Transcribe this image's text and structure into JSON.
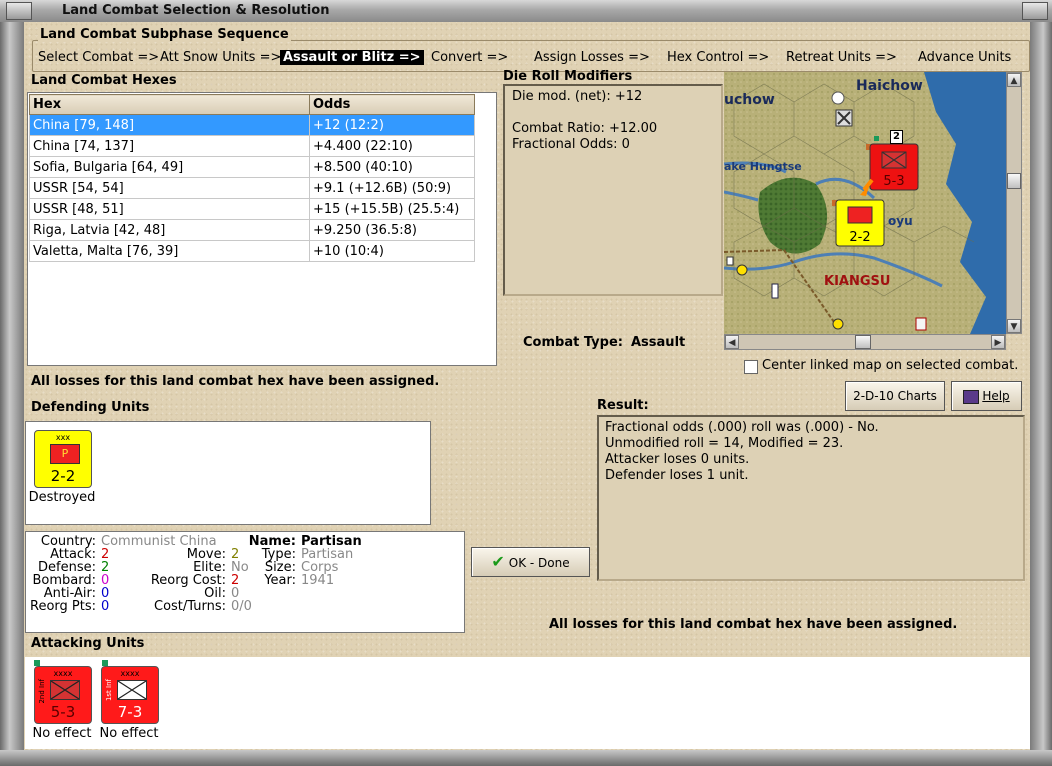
{
  "window": {
    "title": "Land Combat Selection & Resolution"
  },
  "subphase": {
    "title": "Land Combat Subphase Sequence",
    "phases": [
      "Select Combat =>",
      "Att Snow Units =>",
      "Assault or Blitz =>",
      "Convert =>",
      "Assign Losses =>",
      "Hex Control =>",
      "Retreat Units =>",
      "Advance Units"
    ],
    "current_index": 2
  },
  "hexes": {
    "title": "Land Combat Hexes",
    "columns": [
      "Hex",
      "Odds"
    ],
    "rows": [
      [
        "China [79, 148]",
        "+12 (12:2)"
      ],
      [
        "China [74, 137]",
        "+4.400 (22:10)"
      ],
      [
        "Sofia, Bulgaria [64, 49]",
        "+8.500 (40:10)"
      ],
      [
        "USSR [54, 54]",
        "+9.1 (+12.6B) (50:9)"
      ],
      [
        "USSR [48, 51]",
        "+15 (+15.5B) (25.5:4)"
      ],
      [
        "Riga, Latvia [42, 48]",
        "+9.250 (36.5:8)"
      ],
      [
        "Valetta, Malta [76, 39]",
        "+10 (10:4)"
      ]
    ],
    "selected_row": 0
  },
  "die_roll": {
    "title": "Die Roll Modifiers",
    "lines": [
      "Die mod. (net): +12",
      "",
      "Combat Ratio: +12.00",
      "Fractional Odds: 0"
    ]
  },
  "combat_type": {
    "label": "Combat Type:",
    "value": "Assault"
  },
  "map": {
    "labels": {
      "haichow": "Haichow",
      "suchow": "uchow",
      "lake": "ake Hungtse",
      "kiangsu": "KIANGSU",
      "oyu": "oyu"
    },
    "stack_count": "2",
    "center_checkbox_label": "Center linked map on selected combat.",
    "center_checked": false
  },
  "losses_msg": "All losses for this land combat hex have been assigned.",
  "defending": {
    "title": "Defending Units",
    "units": [
      {
        "size": "xxx",
        "symbol": "P",
        "strength": "2-2",
        "status": "Destroyed",
        "color": "#ffff00"
      }
    ]
  },
  "unit_info": {
    "country_label": "Country:",
    "country": "Communist China",
    "attack_label": "Attack:",
    "attack": "2",
    "defense_label": "Defense:",
    "defense": "2",
    "bombard_label": "Bombard:",
    "bombard": "0",
    "antiair_label": "Anti-Air:",
    "antiair": "0",
    "reorg_label": "Reorg Pts:",
    "reorg": "0",
    "move_label": "Move:",
    "move": "2",
    "elite_label": "Elite:",
    "elite": "No",
    "reorgcost_label": "Reorg Cost:",
    "reorgcost": "2",
    "oil_label": "Oil:",
    "oil": "0",
    "costturns_label": "Cost/Turns:",
    "costturns": "0/0",
    "name_label": "Name:",
    "name": "Partisan",
    "type_label": "Type:",
    "type": "Partisan",
    "size_label": "Size:",
    "size": "Corps",
    "year_label": "Year:",
    "year": "1941"
  },
  "buttons": {
    "charts": "2-D-10 Charts",
    "help": "Help",
    "ok": "OK - Done"
  },
  "result": {
    "title": "Result:",
    "lines": [
      "Fractional odds (.000) roll was (.000)  - No.",
      "Unmodified roll = 14, Modified = 23.",
      "Attacker loses 0 units.",
      "Defender loses 1 unit."
    ]
  },
  "losses_msg2": "All losses for this land combat hex have been assigned.",
  "attacking": {
    "title": "Attacking Units",
    "units": [
      {
        "size": "xxxx",
        "side": "2nd Inf",
        "strength": "5-3",
        "status": "No effect",
        "color": "#ff1a1a"
      },
      {
        "size": "xxxx",
        "side": "1st Inf",
        "strength": "7-3",
        "status": "No effect",
        "color": "#ff1a1a"
      }
    ]
  },
  "colors": {
    "accent_select": "#3399ff",
    "attack": "#cc0000",
    "defense": "#008000",
    "bombard": "#cc00cc",
    "antiair": "#0000cc",
    "reorg": "#0000cc",
    "move": "#808000",
    "reorgcost": "#cc0000"
  }
}
